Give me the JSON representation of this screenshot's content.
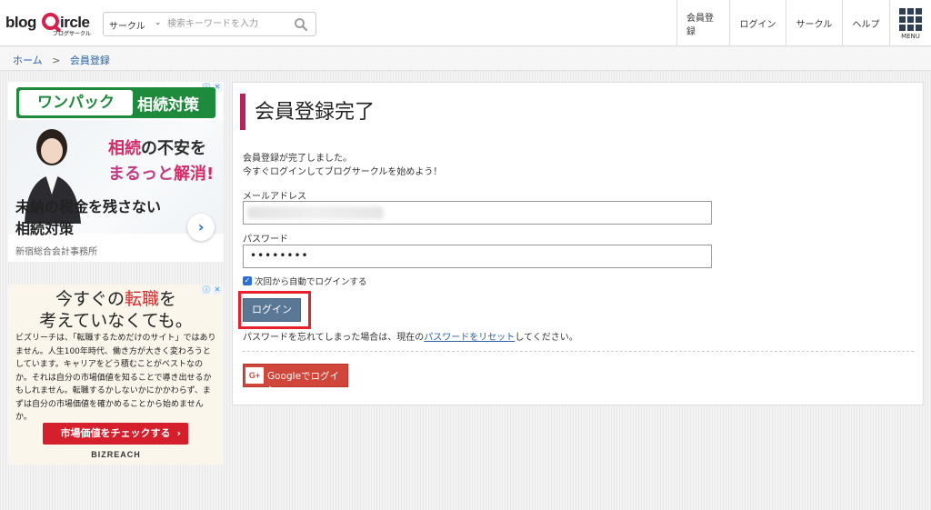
{
  "header": {
    "logo_text_left": "blog",
    "logo_text_right": "ircle",
    "logo_sub": "ブログサークル",
    "search": {
      "category": "サークル",
      "placeholder": "検索キーワードを入力"
    },
    "nav": [
      {
        "label": "会員登録"
      },
      {
        "label": "ログイン"
      },
      {
        "label": "サークル"
      },
      {
        "label": "ヘルプ"
      }
    ],
    "menu_label": "MENU"
  },
  "breadcrumb": {
    "home": "ホーム",
    "separator": ">",
    "current": "会員登録"
  },
  "ads": {
    "ad1": {
      "banner_left": "ワンパック",
      "banner_right": "相続対策",
      "tagline_1a": "相続",
      "tagline_1b": "の不安を",
      "tagline_2a": "まるっと",
      "tagline_2b": "解消!",
      "headline_1": "未納の税金を残さない",
      "headline_2": "相続対策",
      "sponsor": "新宿総合会計事務所",
      "arrow": "›"
    },
    "ad2": {
      "title_1a": "今すぐの",
      "title_1b": "転職",
      "title_1c": "を",
      "title_2": "考えていなくても。",
      "body": "ビズリーチは、「転職するためだけのサイト」ではありません。人生100年時代、働き方が大きく変わろうとしています。キャリアをどう積むことがベストなのか。それは自分の市場価値を知ることで導き出せるかもしれません。転職するかしないかにかかわらず、まずは自分の市場価値を確かめることから始めませんか。",
      "button": "市場価値をチェックする",
      "button_chevron": "›",
      "brand": "BIZREACH"
    }
  },
  "main": {
    "title": "会員登録完了",
    "message_1": "会員登録が完了しました。",
    "message_2": "今すぐログインしてブログサークルを始めよう！",
    "email_label": "メールアドレス",
    "password_label": "パスワード",
    "password_value": "••••••••",
    "remember_label": "次回から自動でログインする",
    "remember_checked": true,
    "login_button": "ログイン",
    "forgot_prefix": "パスワードを忘れてしまった場合は、現在の",
    "forgot_link": "パスワードをリセット",
    "forgot_suffix": "してください。",
    "google_icon_text": "G+",
    "google_button": "Googleでログイン"
  },
  "colors": {
    "accent_bar": "#b5245b",
    "login_button": "#5a7796",
    "highlight": "#e8212c",
    "google": "#d0463a",
    "link": "#2a62a8"
  }
}
